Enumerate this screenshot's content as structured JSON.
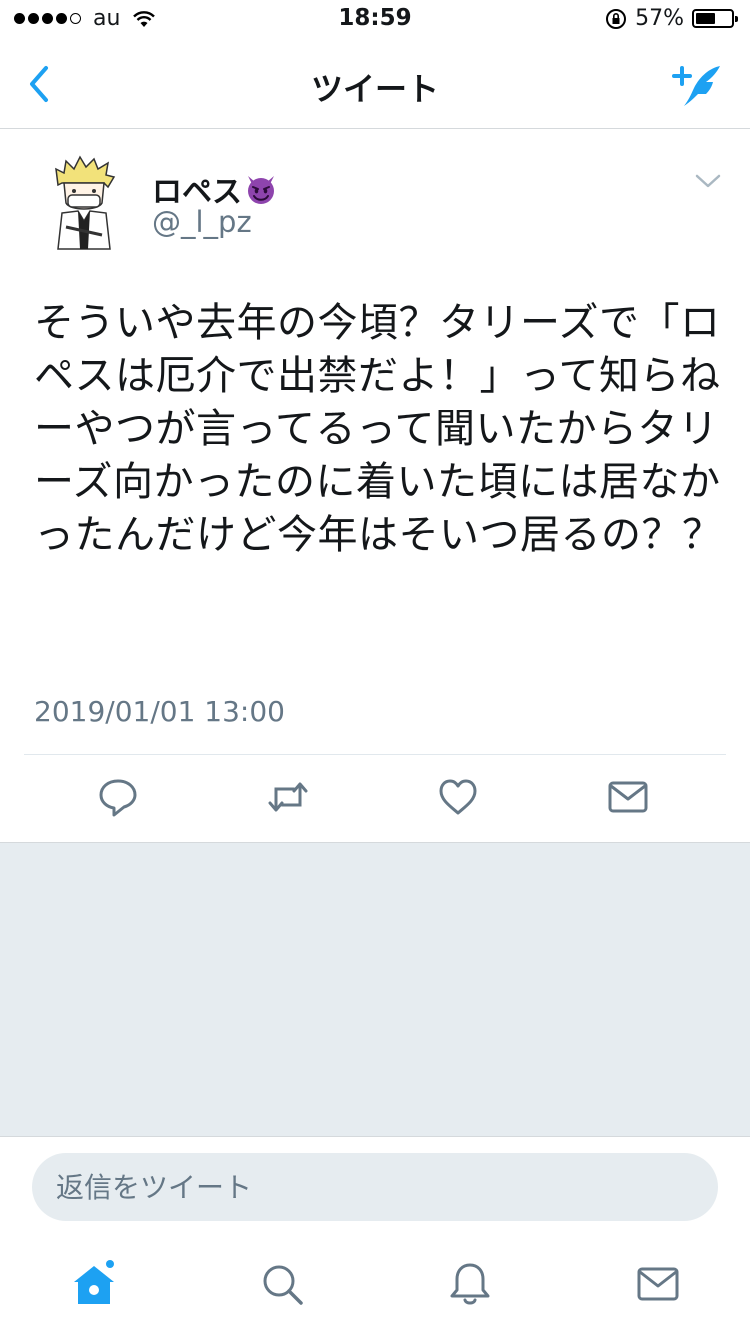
{
  "status_bar": {
    "carrier": "au",
    "time": "18:59",
    "battery": "57%",
    "battery_level": 0.57
  },
  "nav": {
    "title": "ツイート",
    "back_icon": "chevron-left-icon",
    "compose_icon": "compose-tweet-icon"
  },
  "tweet": {
    "author_name": "ロペス",
    "author_emoji": "smiling-imp-emoji",
    "handle": "@_l_pz",
    "text": "そういや去年の今頃？タリーズで「ロペスは厄介で出禁だよ！」って知らねーやつが言ってるって聞いたからタリーズ向かったのに着いた頃には居なかったんだけど今年はそいつ居るの？？",
    "timestamp": "2019/01/01 13:00",
    "actions": [
      "reply-icon",
      "retweet-icon",
      "like-icon",
      "direct-message-icon"
    ]
  },
  "reply": {
    "placeholder": "返信をツイート"
  },
  "tabs": [
    "home-icon",
    "search-icon",
    "notifications-icon",
    "messages-icon"
  ],
  "colors": {
    "accent": "#1da1f2",
    "muted": "#657786",
    "background_gray": "#e6ecf0"
  }
}
